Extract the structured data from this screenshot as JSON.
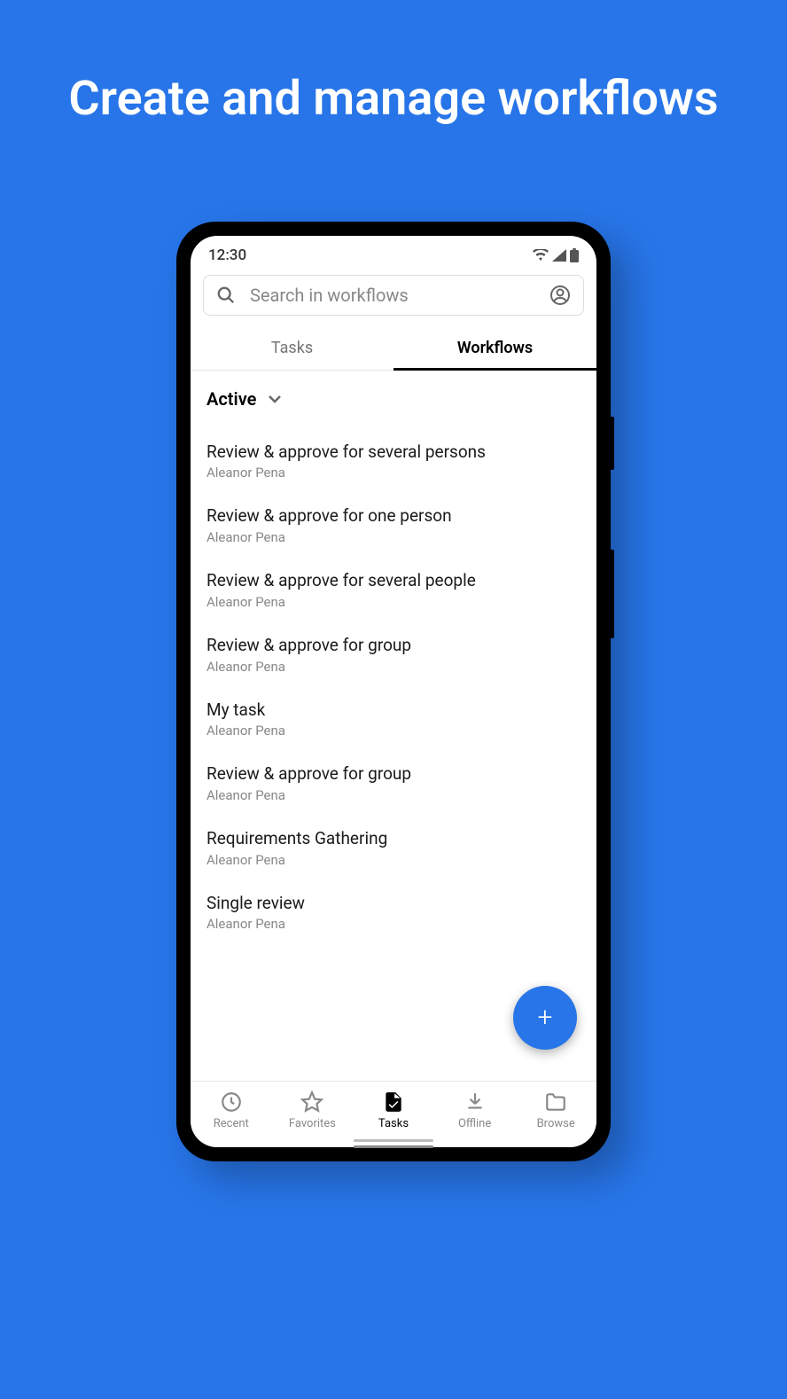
{
  "promo": {
    "title": "Create and manage workflows"
  },
  "status_bar": {
    "time": "12:30"
  },
  "search": {
    "placeholder": "Search in workflows"
  },
  "tabs": [
    {
      "label": "Tasks",
      "active": false
    },
    {
      "label": "Workflows",
      "active": true
    }
  ],
  "filter": {
    "label": "Active"
  },
  "workflows": [
    {
      "title": "Review & approve for several persons",
      "author": "Aleanor Pena"
    },
    {
      "title": "Review & approve for one person",
      "author": "Aleanor Pena"
    },
    {
      "title": "Review & approve for several people",
      "author": "Aleanor Pena"
    },
    {
      "title": "Review & approve for group",
      "author": "Aleanor Pena"
    },
    {
      "title": "My task",
      "author": "Aleanor Pena"
    },
    {
      "title": "Review & approve for group",
      "author": "Aleanor Pena"
    },
    {
      "title": "Requirements Gathering",
      "author": "Aleanor Pena"
    },
    {
      "title": "Single review",
      "author": "Aleanor Pena"
    }
  ],
  "bottom_nav": [
    {
      "label": "Recent",
      "active": false
    },
    {
      "label": "Favorites",
      "active": false
    },
    {
      "label": "Tasks",
      "active": true
    },
    {
      "label": "Offline",
      "active": false
    },
    {
      "label": "Browse",
      "active": false
    }
  ]
}
